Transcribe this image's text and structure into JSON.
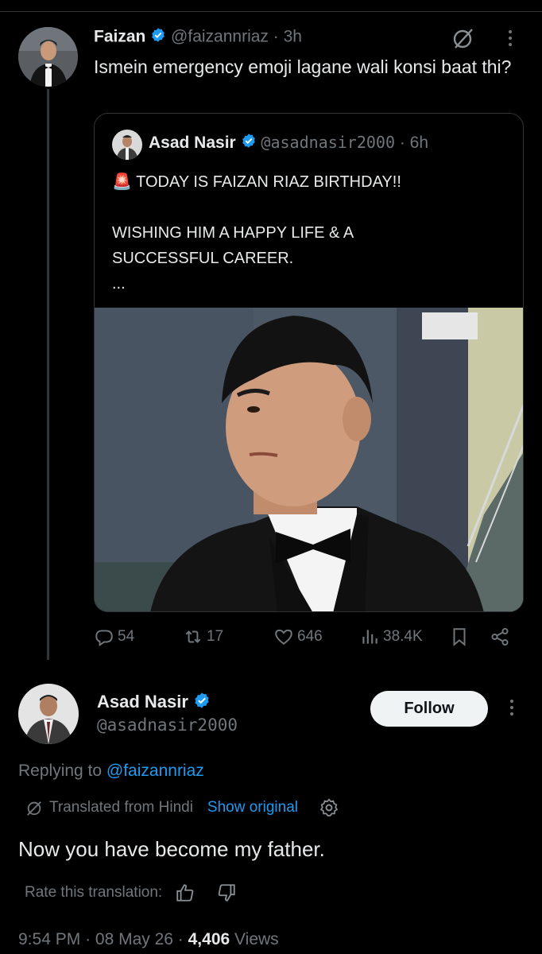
{
  "colors": {
    "background": "#000000",
    "text": "#e7e9ea",
    "muted": "#71767b",
    "link": "#1d9bf0",
    "verified": "#1d9bf0",
    "border": "#2f3336"
  },
  "parent_tweet": {
    "author_name": "Faizan",
    "author_handle": "@faizannriaz",
    "time": "· 3h",
    "text": "Ismein emergency emoji lagane wali konsi baat thi?"
  },
  "quoted_tweet": {
    "author_name": "Asad Nasir",
    "author_handle": "@asadnasir2000",
    "time": "· 6h",
    "emoji": "🚨",
    "line1": "TODAY IS FAIZAN RIAZ BIRTHDAY!!",
    "line2": "WISHING HIM A HAPPY LIFE & A",
    "line3": "SUCCESSFUL CAREER.",
    "ellipsis": "..."
  },
  "actions": {
    "replies": "54",
    "reposts": "17",
    "likes": "646",
    "views": "38.4K"
  },
  "reply_tweet": {
    "author_name": "Asad Nasir",
    "author_handle": "@asadnasir2000",
    "follow_label": "Follow",
    "replying_prefix": "Replying to",
    "replying_handle": "@faizannriaz",
    "translated_from": "Translated from Hindi",
    "show_original": "Show original",
    "text": "Now you have become my father.",
    "rate_label": "Rate this translation:",
    "time": "9:54 PM",
    "date": "08 May 26",
    "views_count": "4,406",
    "views_label": "Views"
  },
  "icons": [
    "verified-badge-icon",
    "grok-icon",
    "more-icon",
    "reply-icon",
    "repost-icon",
    "like-icon",
    "views-icon",
    "bookmark-icon",
    "share-icon",
    "translate-icon",
    "gear-icon",
    "thumbs-up-icon",
    "thumbs-down-icon"
  ]
}
